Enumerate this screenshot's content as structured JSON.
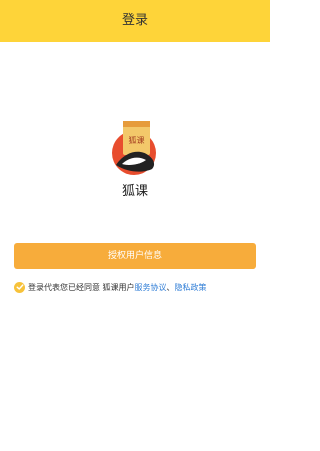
{
  "header": {
    "title": "登录"
  },
  "app": {
    "name": "狐课",
    "logo_text": "狐课"
  },
  "auth_button": {
    "label": "授权用户信息"
  },
  "agreement": {
    "prefix": "登录代表您已经同意 狐课用户",
    "service_link": "服务协议",
    "separator": "、",
    "privacy_link": "隐私政策",
    "checked": true
  },
  "colors": {
    "header_bg": "#fed439",
    "button_bg": "#f7ac3b",
    "link": "#2f7dd6"
  }
}
